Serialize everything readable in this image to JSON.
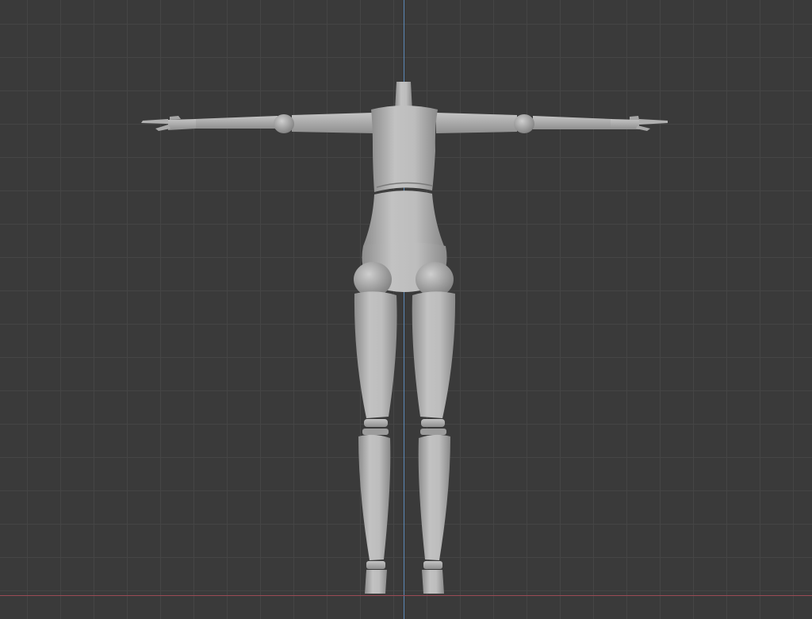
{
  "viewport": {
    "background_color": "#3a3a3a",
    "grid_color": "#454545",
    "axis_y_color": "#5b88b6",
    "axis_x_color": "#9a4a55",
    "model_color": "#b9b9b9"
  }
}
